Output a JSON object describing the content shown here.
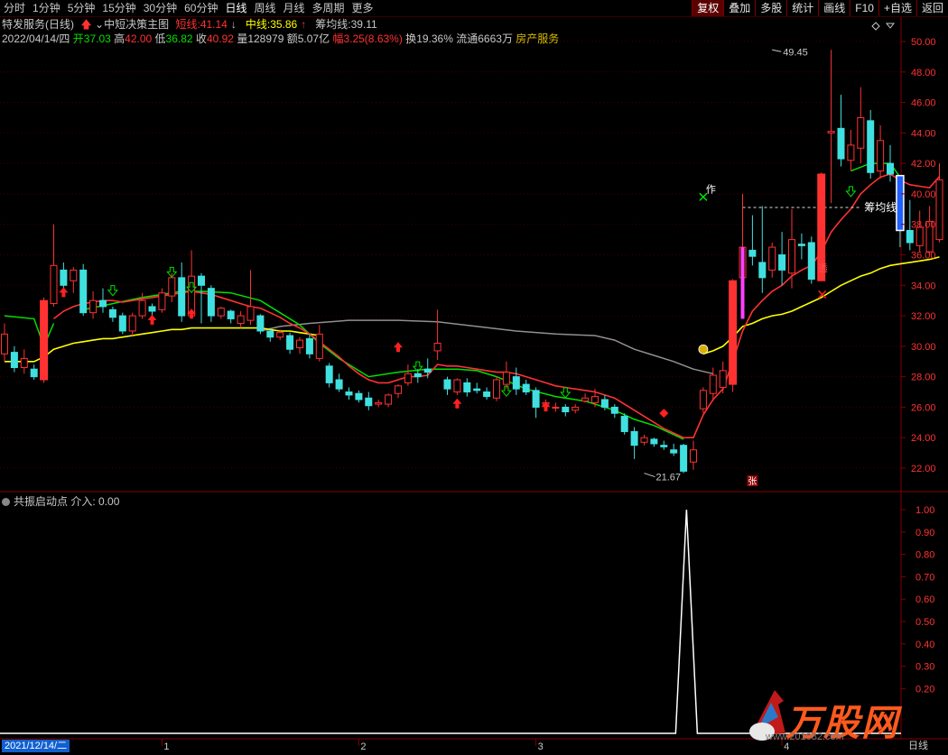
{
  "toolbar": {
    "tabs": [
      "分时",
      "1分钟",
      "5分钟",
      "15分钟",
      "30分钟",
      "60分钟",
      "日线",
      "周线",
      "月线",
      "多周期",
      "更多"
    ],
    "active_tab": "日线",
    "right_buttons": [
      "复权",
      "叠加",
      "多股",
      "统计",
      "画线",
      "F10",
      "+自选",
      "返回"
    ]
  },
  "info": {
    "stock_name": "特发服务",
    "period": "(日线)",
    "indicator_name": "中短决策主图",
    "short_line_label": "短线:",
    "short_line_value": "41.14",
    "mid_line_label": "中线:",
    "mid_line_value": "35.86",
    "cost_line_label": "筹均线:",
    "cost_line_value": "39.11",
    "date": "2022/04/14/四",
    "open_label": "开",
    "open": "37.03",
    "high_label": "高",
    "high": "42.00",
    "low_label": "低",
    "low": "36.82",
    "close_label": "收",
    "close": "40.92",
    "volume_label": "量",
    "volume": "128979",
    "amount_label": "额",
    "amount": "5.07亿",
    "change_label": "幅",
    "change": "3.25(8.63%)",
    "turnover_label": "换",
    "turnover": "19.36%",
    "float_label": "流通",
    "float_cap": "6663万",
    "sector": "房产服务"
  },
  "annotations": {
    "high_mark": "49.45",
    "low_mark": "21.67",
    "cost_line_tag": "筹均线",
    "zuo": "作",
    "tou": "透",
    "zhang": "张"
  },
  "sub_indicator": {
    "title": "共振启动点",
    "entry_label": "介入:",
    "entry_value": "0.00"
  },
  "bottom": {
    "date_box": "2021/12/14/二",
    "month_ticks": [
      "1",
      "2",
      "3",
      "4"
    ],
    "period_btn": "日线"
  },
  "watermark": {
    "brand": "万股网",
    "url": "www.201082.com"
  },
  "colors": {
    "up": "#ff3232",
    "down": "#40e0e0",
    "short_line": "#ff3232",
    "mid_line": "#ffff00",
    "trend_green": "#00e000",
    "trend_gray": "#909090",
    "grid": "#800000"
  },
  "chart_data": {
    "type": "candlestick",
    "y_axis_main": {
      "ticks": [
        "50.00",
        "48.00",
        "46.00",
        "44.00",
        "42.00",
        "40.00",
        "38.00",
        "36.00",
        "34.00",
        "32.00",
        "30.00",
        "28.00",
        "26.00",
        "24.00",
        "22.00"
      ],
      "range": [
        21,
        51
      ]
    },
    "y_axis_sub": {
      "ticks": [
        "1.00",
        "0.90",
        "0.80",
        "0.70",
        "0.60",
        "0.50",
        "0.40",
        "0.30",
        "0.20"
      ],
      "range": [
        0,
        1.1
      ]
    },
    "candles": [
      [
        29.5,
        30.8,
        31.5,
        29.0
      ],
      [
        29.6,
        28.6,
        30.0,
        28.3
      ],
      [
        28.6,
        29.2,
        29.8,
        28.2
      ],
      [
        28.5,
        28.0,
        28.8,
        27.8
      ],
      [
        27.8,
        33.0,
        33.2,
        27.6
      ],
      [
        32.8,
        35.3,
        38.0,
        32.6
      ],
      [
        35.0,
        34.0,
        35.5,
        33.6
      ],
      [
        34.3,
        35.0,
        35.2,
        33.5
      ],
      [
        35.0,
        32.2,
        35.4,
        32.0
      ],
      [
        32.2,
        33.0,
        33.6,
        31.8
      ],
      [
        33.0,
        32.6,
        33.8,
        32.2
      ],
      [
        32.4,
        31.9,
        32.6,
        31.6
      ],
      [
        32.0,
        31.0,
        32.2,
        30.8
      ],
      [
        31.0,
        32.0,
        32.2,
        30.7
      ],
      [
        32.0,
        33.0,
        33.5,
        31.8
      ],
      [
        32.6,
        32.3,
        32.8,
        31.9
      ],
      [
        32.4,
        33.5,
        33.8,
        32.2
      ],
      [
        33.3,
        34.5,
        34.8,
        32.9
      ],
      [
        34.5,
        32.0,
        35.5,
        31.6
      ],
      [
        32.0,
        34.6,
        36.3,
        31.8
      ],
      [
        34.6,
        34.0,
        34.8,
        31.5
      ],
      [
        33.8,
        32.0,
        34.0,
        31.6
      ],
      [
        32.0,
        32.5,
        32.6,
        31.8
      ],
      [
        32.3,
        31.8,
        32.4,
        31.5
      ],
      [
        31.5,
        32.0,
        32.3,
        31.2
      ],
      [
        31.7,
        32.6,
        35.0,
        31.4
      ],
      [
        32.0,
        31.0,
        32.1,
        30.8
      ],
      [
        31.0,
        30.6,
        31.2,
        30.3
      ],
      [
        30.6,
        30.9,
        31.1,
        30.4
      ],
      [
        30.7,
        29.8,
        30.9,
        29.5
      ],
      [
        29.9,
        30.4,
        30.6,
        29.5
      ],
      [
        30.5,
        29.5,
        30.8,
        29.2
      ],
      [
        29.2,
        30.8,
        31.4,
        29.0
      ],
      [
        28.7,
        27.6,
        28.9,
        27.3
      ],
      [
        27.8,
        27.2,
        28.2,
        27.0
      ],
      [
        27.0,
        26.8,
        27.3,
        26.5
      ],
      [
        26.9,
        26.5,
        27.1,
        26.3
      ],
      [
        26.6,
        26.1,
        27.0,
        25.8
      ],
      [
        26.2,
        26.3,
        26.5,
        26.0
      ],
      [
        26.2,
        26.8,
        26.9,
        26.0
      ],
      [
        26.9,
        27.4,
        27.5,
        26.6
      ],
      [
        27.6,
        28.2,
        28.8,
        27.4
      ],
      [
        28.2,
        28.0,
        28.5,
        27.6
      ],
      [
        28.5,
        28.3,
        29.2,
        27.9
      ],
      [
        29.7,
        30.2,
        32.4,
        29.1
      ],
      [
        27.8,
        27.2,
        28.0,
        26.8
      ],
      [
        27.0,
        27.8,
        27.9,
        26.8
      ],
      [
        27.6,
        27.0,
        27.9,
        26.7
      ],
      [
        27.2,
        27.1,
        27.6,
        26.9
      ],
      [
        27.0,
        26.7,
        27.3,
        26.5
      ],
      [
        26.6,
        27.8,
        28.0,
        26.4
      ],
      [
        27.5,
        28.3,
        29.0,
        27.2
      ],
      [
        28.0,
        27.2,
        28.6,
        26.8
      ],
      [
        27.5,
        27.0,
        27.8,
        26.8
      ],
      [
        27.1,
        26.0,
        27.3,
        25.3
      ],
      [
        26.2,
        26.3,
        26.5,
        25.9
      ],
      [
        26.0,
        26.0,
        26.3,
        25.7
      ],
      [
        26.0,
        25.7,
        26.2,
        25.4
      ],
      [
        25.8,
        26.0,
        26.2,
        25.6
      ],
      [
        26.4,
        26.6,
        26.9,
        26.3
      ],
      [
        26.3,
        26.7,
        27.2,
        26.0
      ],
      [
        26.5,
        26.0,
        26.8,
        25.8
      ],
      [
        26.0,
        25.6,
        26.2,
        25.3
      ],
      [
        25.4,
        24.4,
        25.6,
        24.2
      ],
      [
        24.4,
        23.5,
        24.7,
        22.6
      ],
      [
        23.7,
        24.0,
        24.2,
        23.5
      ],
      [
        23.9,
        23.6,
        24.0,
        23.4
      ],
      [
        23.5,
        23.4,
        23.8,
        23.2
      ],
      [
        23.2,
        23.0,
        23.6,
        22.8
      ],
      [
        23.5,
        21.8,
        23.6,
        21.67
      ],
      [
        22.4,
        23.2,
        23.8,
        21.9
      ],
      [
        25.9,
        27.1,
        27.3,
        25.6
      ],
      [
        26.9,
        28.1,
        28.6,
        26.4
      ],
      [
        27.3,
        28.4,
        29.0,
        26.9
      ],
      [
        27.5,
        34.3,
        34.4,
        27.0
      ],
      [
        34.5,
        36.5,
        40.0,
        34.0
      ],
      [
        36.3,
        35.9,
        38.6,
        35.3
      ],
      [
        35.5,
        34.5,
        39.2,
        33.5
      ],
      [
        35.0,
        36.5,
        36.8,
        34.5
      ],
      [
        36.0,
        35.0,
        37.5,
        34.0
      ],
      [
        34.8,
        37.0,
        39.0,
        33.8
      ],
      [
        36.7,
        36.6,
        37.4,
        35.7
      ],
      [
        36.8,
        34.4,
        37.2,
        34.1
      ],
      [
        34.3,
        41.3,
        41.4,
        34.3
      ],
      [
        44.0,
        44.1,
        49.45,
        39.4
      ],
      [
        44.3,
        42.3,
        46.5,
        41.8
      ],
      [
        42.2,
        43.2,
        44.2,
        41.5
      ],
      [
        43.0,
        45.0,
        47.0,
        42.0
      ],
      [
        44.8,
        41.4,
        45.5,
        41.0
      ],
      [
        41.5,
        43.5,
        44.5,
        41.0
      ],
      [
        42.0,
        41.3,
        43.2,
        40.8
      ],
      [
        40.6,
        37.6,
        40.8,
        36.5
      ],
      [
        37.6,
        36.8,
        39.6,
        36.3
      ],
      [
        36.6,
        37.8,
        38.9,
        36.2
      ],
      [
        36.2,
        38.2,
        39.2,
        36.0
      ],
      [
        37.0,
        40.92,
        42.0,
        36.82
      ]
    ],
    "short_line": [
      null,
      null,
      null,
      null,
      null,
      31.8,
      32.3,
      32.6,
      32.8,
      32.9,
      33.0,
      33.0,
      32.9,
      33.0,
      33.1,
      33.2,
      33.3,
      33.4,
      33.5,
      33.6,
      33.5,
      33.4,
      33.2,
      33.0,
      32.8,
      32.6,
      32.5,
      32.2,
      31.9,
      31.5,
      31.2,
      30.8,
      30.3,
      29.8,
      29.3,
      28.7,
      28.2,
      27.8,
      27.6,
      27.6,
      27.8,
      28.0,
      28.0,
      28.1,
      28.8,
      28.7,
      28.7,
      28.6,
      28.5,
      28.4,
      28.3,
      28.3,
      28.2,
      28.0,
      27.8,
      27.6,
      27.4,
      27.3,
      27.2,
      27.1,
      27.0,
      26.8,
      26.6,
      26.2,
      25.8,
      25.4,
      25.0,
      24.6,
      24.3,
      24.0,
      24.0,
      25.5,
      26.5,
      27.2,
      29.0,
      31.0,
      32.3,
      33.0,
      33.6,
      34.0,
      34.6,
      35.0,
      35.3,
      36.2,
      37.5,
      38.3,
      39.0,
      40.0,
      40.6,
      41.1,
      41.3,
      40.9,
      40.6,
      40.5,
      40.4,
      41.14
    ],
    "mid_line": [
      29.0,
      29.0,
      29.0,
      29.0,
      29.3,
      29.8,
      30.0,
      30.2,
      30.3,
      30.4,
      30.5,
      30.5,
      30.6,
      30.7,
      30.8,
      30.9,
      31.0,
      31.1,
      31.1,
      31.2,
      31.2,
      31.2,
      31.2,
      31.2,
      31.2,
      31.2,
      31.2,
      31.1,
      31.0,
      31.0,
      30.9,
      30.8,
      30.7
    ],
    "mid_line_late": [
      [
        71,
        29.5
      ],
      [
        72,
        29.7
      ],
      [
        73,
        30.0
      ],
      [
        74,
        30.6
      ],
      [
        75,
        31.3
      ],
      [
        76,
        31.5
      ],
      [
        77,
        31.8
      ],
      [
        78,
        32.0
      ],
      [
        79,
        32.1
      ],
      [
        80,
        32.3
      ],
      [
        81,
        32.6
      ],
      [
        82,
        32.9
      ],
      [
        83,
        33.2
      ],
      [
        84,
        33.6
      ],
      [
        85,
        34.0
      ],
      [
        86,
        34.3
      ],
      [
        87,
        34.6
      ],
      [
        88,
        34.8
      ],
      [
        89,
        35.1
      ],
      [
        90,
        35.3
      ],
      [
        91,
        35.4
      ],
      [
        92,
        35.5
      ],
      [
        93,
        35.6
      ],
      [
        94,
        35.7
      ],
      [
        95,
        35.86
      ]
    ],
    "cost_line_value": 39.11,
    "sub_spike": {
      "index": 69,
      "value": 1.0
    }
  }
}
